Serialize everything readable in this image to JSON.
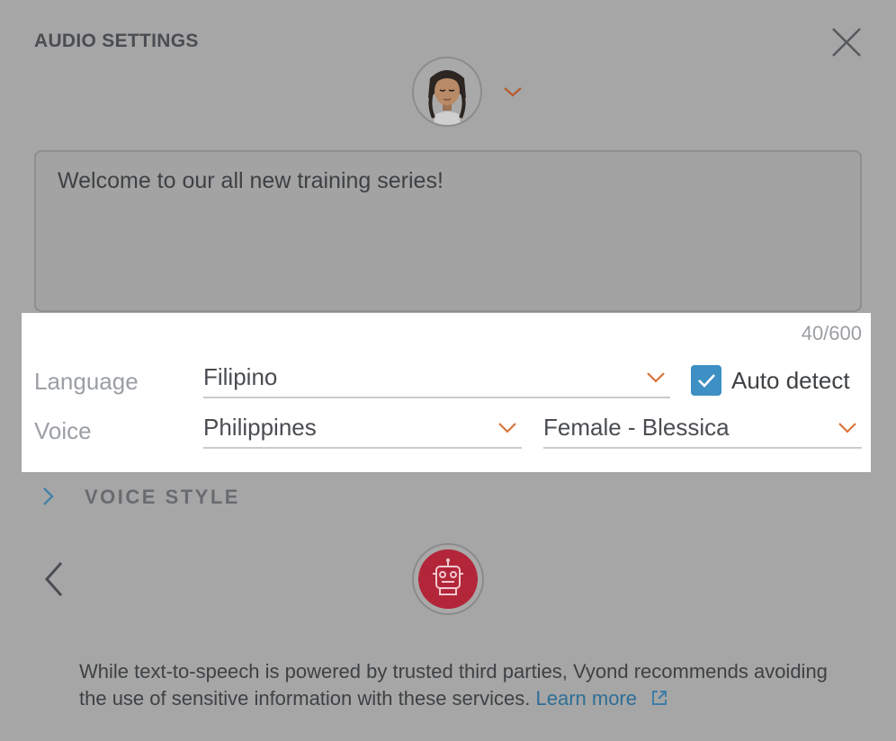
{
  "dialog": {
    "title": "AUDIO SETTINGS",
    "script_text": "Welcome to our all new training series!",
    "char_counter": "40/600"
  },
  "settings": {
    "language_label": "Language",
    "language_value": "Filipino",
    "auto_detect_label": "Auto detect",
    "auto_detect_checked": true,
    "voice_label": "Voice",
    "region_value": "Philippines",
    "voice_value": "Female - Blessica"
  },
  "voice_style": {
    "label": "VOICE STYLE"
  },
  "footer": {
    "disclaimer": "While text-to-speech is powered by trusted third parties, Vyond recommends avoiding the use of sensitive information with these services.",
    "learn_more": "Learn more"
  },
  "colors": {
    "overlay_bg": "#a6a6a6",
    "accent_orange": "#d9733a",
    "checkbox_blue": "#3d8fc4",
    "record_red": "#b3263a",
    "link_blue": "#2e6e96"
  },
  "icons": {
    "close": "close-icon",
    "avatar_dropdown": "chevron-down-icon",
    "voice_style_expand": "chevron-right-icon",
    "back": "chevron-left-icon",
    "record": "robot-icon",
    "external_link": "external-link-icon"
  }
}
